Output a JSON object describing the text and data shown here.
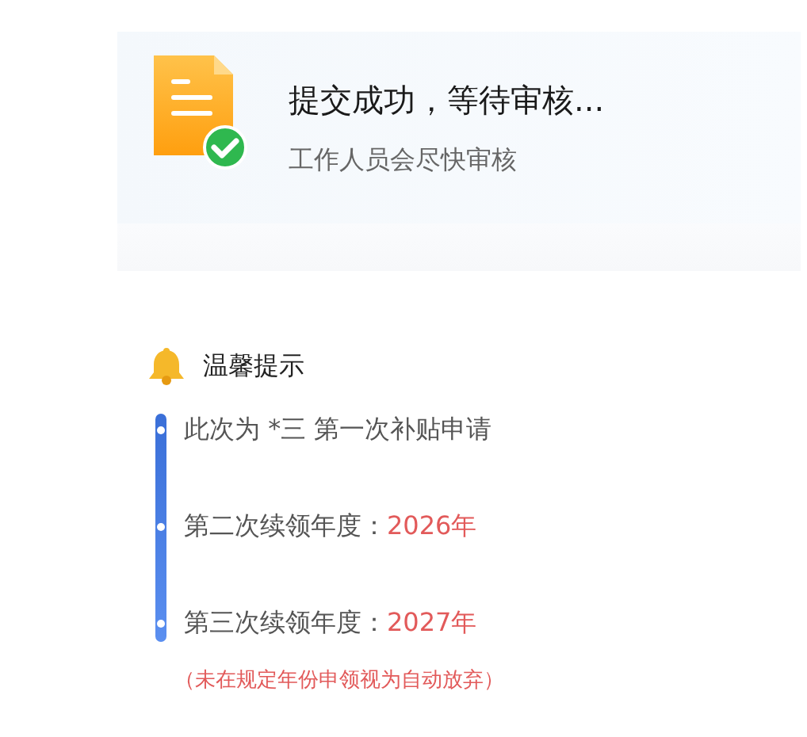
{
  "status_card": {
    "title": "提交成功，等待审核...",
    "subtitle": "工作人员会尽快审核"
  },
  "tips": {
    "title": "温馨提示",
    "items": [
      {
        "label": "此次为 *三 第一次补贴申请"
      },
      {
        "label": "第二次续领年度：",
        "value": "2026年"
      },
      {
        "label": "第三次续领年度：",
        "value": "2027年"
      }
    ],
    "note": "（未在规定年份申领视为自动放弃）"
  }
}
